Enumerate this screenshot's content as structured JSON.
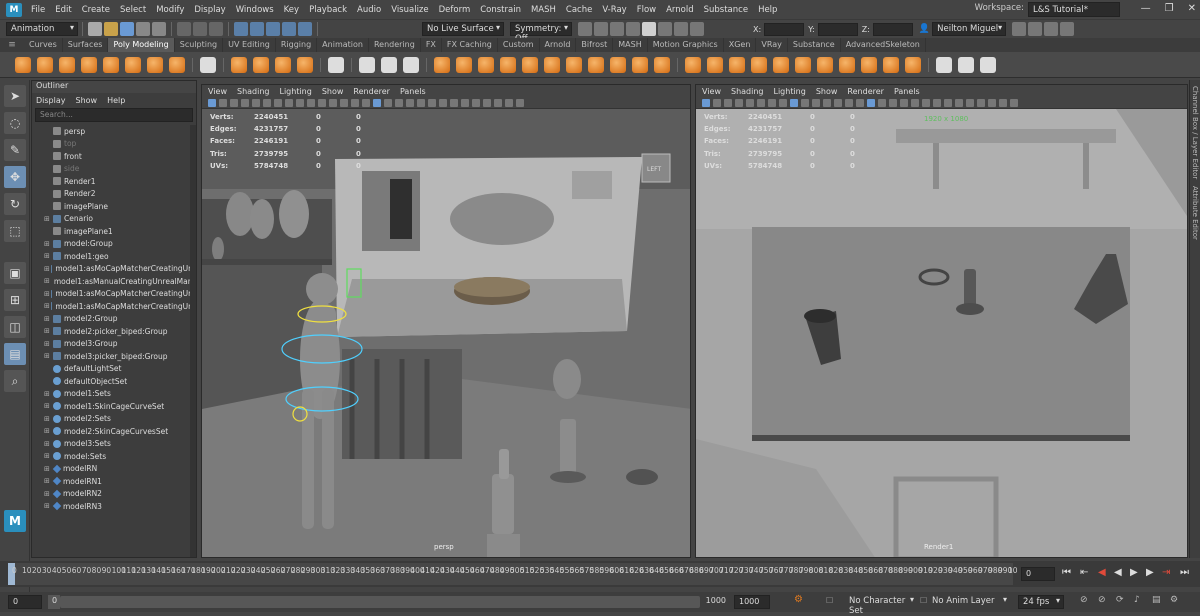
{
  "menubar": {
    "items": [
      "File",
      "Edit",
      "Create",
      "Select",
      "Modify",
      "Display",
      "Windows",
      "Key",
      "Playback",
      "Audio",
      "Visualize",
      "Deform",
      "Constrain",
      "MASH",
      "Cache",
      "V-Ray",
      "Flow",
      "Arnold",
      "Substance",
      "Help"
    ],
    "workspace_label": "Workspace:",
    "workspace_value": "L&S Tutorial*"
  },
  "statusline": {
    "mode": "Animation",
    "live_surface": "No Live Surface",
    "symmetry": "Symmetry: Off",
    "x_label": "X:",
    "y_label": "Y:",
    "z_label": "Z:",
    "user": "Neilton Miguel"
  },
  "shelf_tabs": [
    "Curves",
    "Surfaces",
    "Poly Modeling",
    "Sculpting",
    "UV Editing",
    "Rigging",
    "Animation",
    "Rendering",
    "FX",
    "FX Caching",
    "Custom",
    "Arnold",
    "Bifrost",
    "MASH",
    "Motion Graphics",
    "XGen",
    "VRay",
    "Substance",
    "AdvancedSkeleton"
  ],
  "active_shelf_tab": "Poly Modeling",
  "outliner": {
    "title": "Outliner",
    "menu": [
      "Display",
      "Show",
      "Help"
    ],
    "search_placeholder": "Search...",
    "items": [
      {
        "label": "persp",
        "icon": "camera",
        "plus": false,
        "dim": false
      },
      {
        "label": "top",
        "icon": "camera",
        "plus": false,
        "dim": true
      },
      {
        "label": "front",
        "icon": "camera",
        "plus": false,
        "dim": false
      },
      {
        "label": "side",
        "icon": "camera",
        "plus": false,
        "dim": true
      },
      {
        "label": "Render1",
        "icon": "camera",
        "plus": false,
        "dim": false
      },
      {
        "label": "Render2",
        "icon": "camera",
        "plus": false,
        "dim": false
      },
      {
        "label": "imagePlane",
        "icon": "camera",
        "plus": false,
        "dim": false
      },
      {
        "label": "Cenario",
        "icon": "group",
        "plus": true,
        "dim": false
      },
      {
        "label": "imagePlane1",
        "icon": "camera",
        "plus": false,
        "dim": false
      },
      {
        "label": "model:Group",
        "icon": "group",
        "plus": true,
        "dim": false
      },
      {
        "label": "model1:geo",
        "icon": "group",
        "plus": true,
        "dim": false
      },
      {
        "label": "model1:asMoCapMatcherCreatingUnr",
        "icon": "group",
        "plus": true,
        "dim": false
      },
      {
        "label": "model1:asManualCreatingUnrealMann",
        "icon": "group",
        "plus": true,
        "dim": false
      },
      {
        "label": "model1:asMoCapMatcherCreatingUnr",
        "icon": "group",
        "plus": true,
        "dim": false
      },
      {
        "label": "model1:asMoCapMatcherCreatingUnr",
        "icon": "group",
        "plus": true,
        "dim": false
      },
      {
        "label": "model2:Group",
        "icon": "group",
        "plus": true,
        "dim": false
      },
      {
        "label": "model2:picker_biped:Group",
        "icon": "group",
        "plus": true,
        "dim": false
      },
      {
        "label": "model3:Group",
        "icon": "group",
        "plus": true,
        "dim": false
      },
      {
        "label": "model3:picker_biped:Group",
        "icon": "group",
        "plus": true,
        "dim": false
      },
      {
        "label": "defaultLightSet",
        "icon": "set",
        "plus": false,
        "dim": false
      },
      {
        "label": "defaultObjectSet",
        "icon": "set",
        "plus": false,
        "dim": false
      },
      {
        "label": "model1:Sets",
        "icon": "set",
        "plus": true,
        "dim": false
      },
      {
        "label": "model1:SkinCageCurveSet",
        "icon": "set",
        "plus": true,
        "dim": false
      },
      {
        "label": "model2:Sets",
        "icon": "set",
        "plus": true,
        "dim": false
      },
      {
        "label": "model2:SkinCageCurvesSet",
        "icon": "set",
        "plus": true,
        "dim": false
      },
      {
        "label": "model3:Sets",
        "icon": "set",
        "plus": true,
        "dim": false
      },
      {
        "label": "model:Sets",
        "icon": "set",
        "plus": true,
        "dim": false
      },
      {
        "label": "modelRN",
        "icon": "diamond",
        "plus": true,
        "dim": false
      },
      {
        "label": "modelRN1",
        "icon": "diamond",
        "plus": true,
        "dim": false
      },
      {
        "label": "modelRN2",
        "icon": "diamond",
        "plus": true,
        "dim": false
      },
      {
        "label": "modelRN3",
        "icon": "diamond",
        "plus": true,
        "dim": false
      }
    ]
  },
  "viewport_menu": [
    "View",
    "Shading",
    "Lighting",
    "Show",
    "Renderer",
    "Panels"
  ],
  "hud": [
    {
      "label": "Verts:",
      "a": "2240451",
      "b": "0",
      "c": "0"
    },
    {
      "label": "Edges:",
      "a": "4231757",
      "b": "0",
      "c": "0"
    },
    {
      "label": "Faces:",
      "a": "2246191",
      "b": "0",
      "c": "0"
    },
    {
      "label": "Tris:",
      "a": "2739795",
      "b": "0",
      "c": "0"
    },
    {
      "label": "UVs:",
      "a": "5784748",
      "b": "0",
      "c": "0"
    }
  ],
  "viewport1": {
    "camera": "persp",
    "cube_label": "LEFT"
  },
  "viewport2": {
    "camera": "Render1",
    "resolution": "1920 x 1080"
  },
  "right_strip": [
    "Channel Box / Layer Editor",
    "Attribute Editor"
  ],
  "timeline": {
    "ticks": [
      "0",
      "10",
      "20",
      "30",
      "40",
      "50",
      "60",
      "70",
      "80",
      "90",
      "100",
      "110",
      "120",
      "130",
      "140",
      "150",
      "160",
      "170",
      "180",
      "190",
      "200",
      "210",
      "220",
      "230",
      "240",
      "250",
      "260",
      "270",
      "280",
      "290",
      "300",
      "310",
      "320",
      "330",
      "340",
      "350",
      "360",
      "370",
      "380",
      "390",
      "400",
      "410",
      "420",
      "430",
      "440",
      "450",
      "460",
      "470",
      "480",
      "490",
      "500",
      "510",
      "520",
      "530",
      "540",
      "550",
      "560",
      "570",
      "580",
      "590",
      "600",
      "610",
      "620",
      "630",
      "640",
      "650",
      "660",
      "670",
      "680",
      "690",
      "700",
      "710",
      "720",
      "730",
      "740",
      "750",
      "760",
      "770",
      "780",
      "790",
      "800",
      "810",
      "820",
      "830",
      "840",
      "850",
      "860",
      "870",
      "880",
      "890",
      "900",
      "910",
      "920",
      "930",
      "940",
      "950",
      "960",
      "970",
      "980",
      "990",
      "10"
    ],
    "current_frame": "0"
  },
  "range": {
    "start": "0",
    "inner_start": "0",
    "inner_end": "1000",
    "end": "1000",
    "character_set": "No Character Set",
    "anim_layer": "No Anim Layer",
    "fps": "24 fps"
  },
  "colors": {
    "accent": "#6a9ad4",
    "shelf_orange": "#e07a20",
    "stop_red": "#e04a3a"
  }
}
